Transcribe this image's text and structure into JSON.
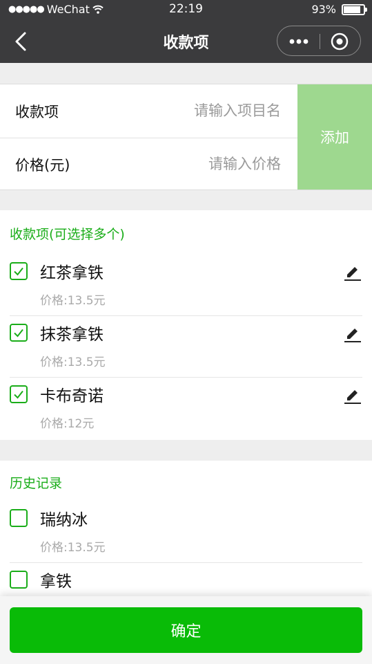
{
  "status_bar": {
    "signal": "●●●●●",
    "carrier": "WeChat",
    "time": "22:19",
    "battery": "93%",
    "battery_level": 0.93
  },
  "nav": {
    "title": "收款项"
  },
  "form": {
    "item_label": "收款项",
    "item_placeholder": "请输入项目名",
    "price_label": "价格(元)",
    "price_placeholder": "请输入价格",
    "add_label": "添加"
  },
  "selected": {
    "title": "收款项(可选择多个)",
    "items": [
      {
        "name": "红茶拿铁",
        "price": "价格:13.5元",
        "checked": true
      },
      {
        "name": "抹茶拿铁",
        "price": "价格:13.5元",
        "checked": true
      },
      {
        "name": "卡布奇诺",
        "price": "价格:12元",
        "checked": true
      }
    ]
  },
  "history": {
    "title": "历史记录",
    "items": [
      {
        "name": "瑞纳冰",
        "price": "价格:13.5元",
        "checked": false
      },
      {
        "name": "拿铁",
        "price": "",
        "checked": false
      }
    ]
  },
  "footer": {
    "confirm_label": "确定"
  },
  "colors": {
    "accent": "#1aad19",
    "confirm": "#09bb07",
    "add_button": "#9ed88f",
    "navbar": "#3b3b3d"
  }
}
